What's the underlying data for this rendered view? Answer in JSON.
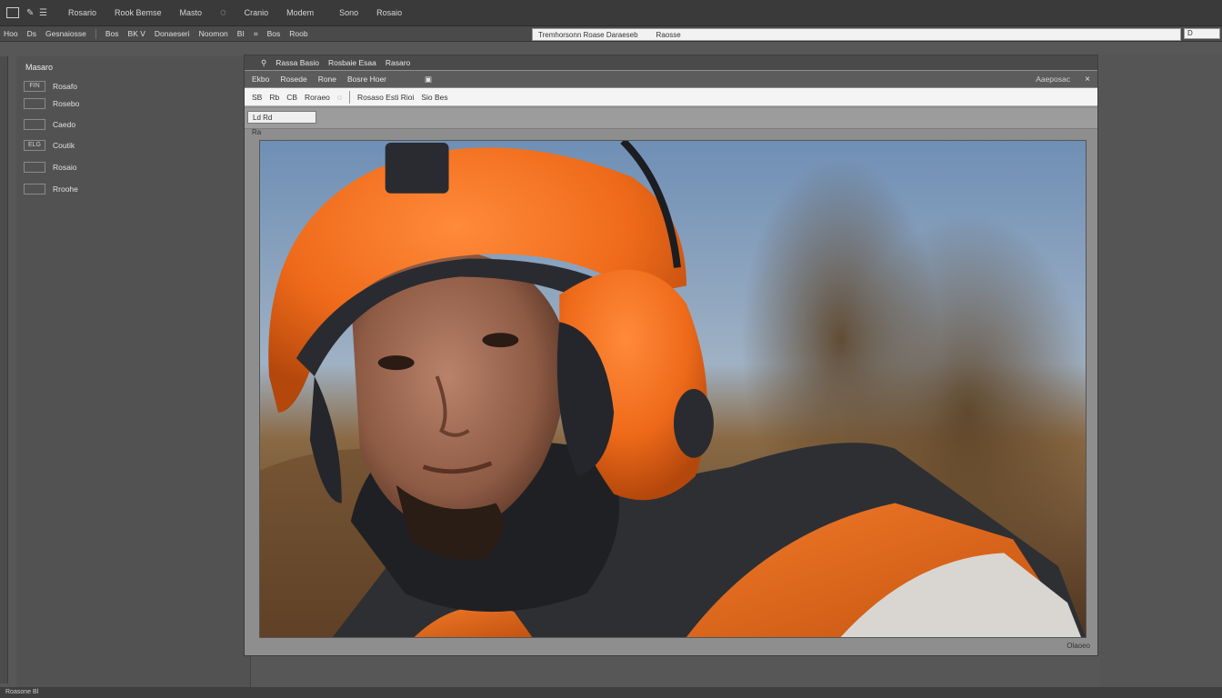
{
  "menubar": {
    "app_icon": "app-logo-icon",
    "items": [
      "Rosario",
      "Rook Bemse",
      "Masto",
      "Cranio",
      "Modem",
      "Sono",
      "Rosaio"
    ]
  },
  "options_bar": {
    "items": [
      "Hoo",
      "Ds",
      "Gesnaiosse",
      "Bos",
      "BK V",
      "Donaeseri",
      "Noomon",
      "BI",
      "Bos",
      "Roob"
    ],
    "field_text": "Tremhorsonn Roase Daraeseb",
    "field_right": "Raosse",
    "small_field": "D"
  },
  "left_panel": {
    "title": "Masaro",
    "rows": [
      {
        "thumb": "FIN",
        "label": "Rosafo"
      },
      {
        "thumb": "",
        "label": "Rosebo"
      },
      {
        "thumb": "",
        "label": "Caedo"
      },
      {
        "thumb": "ELG",
        "label": "Coutik"
      },
      {
        "thumb": "",
        "label": "Rosaio"
      },
      {
        "thumb": "",
        "label": "Rroohe"
      }
    ]
  },
  "document": {
    "title_items": [
      "Rassa Basio",
      "Rosbaie Esaa",
      "Rasaro"
    ],
    "tabs": [
      "Ekbo",
      "Rosede",
      "Rone",
      "Bosre Hoer"
    ],
    "tabs_right": "Aaeposac",
    "toolbar_items": [
      "SB",
      "Rb",
      "CB",
      "Roraeo",
      "Rosaso Esti Rioi",
      "Sio Bes"
    ],
    "mini_panel": "Ld Rd",
    "corner_label": "Ra",
    "zoom": "Olaoeo",
    "photo_alt": "photo-portrait"
  },
  "status_bar": "Roasone Bl",
  "colors": {
    "accent_orange": "#ee6a1a",
    "ui_dark": "#3a3a3a",
    "ui_mid": "#575757"
  }
}
